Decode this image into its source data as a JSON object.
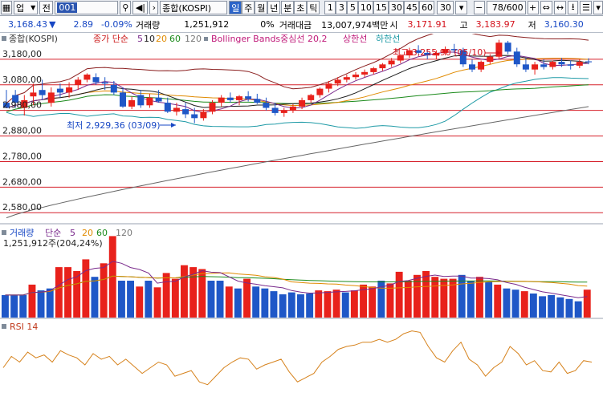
{
  "toolbar": {
    "menu_label": "업",
    "market_label": "전",
    "code": "001",
    "search_value": "종합(KOSPI)",
    "period_buttons": [
      "일",
      "주",
      "월",
      "년",
      "분",
      "초",
      "틱"
    ],
    "interval_buttons": [
      "1",
      "3",
      "5",
      "10",
      "15",
      "30",
      "45",
      "60",
      "30"
    ],
    "count_display": "78/600"
  },
  "quote": {
    "price": "3,168.43",
    "direction_symbol": "▼",
    "change": "2.89",
    "change_pct": "-0.09%",
    "volume_label": "거래량",
    "volume": "1,251,912",
    "volume_pct": "0%",
    "amount_label": "거래대금",
    "amount": "13,007,974백만",
    "open_label": "시",
    "open": "3,171.91",
    "high_label": "고",
    "high": "3,183.97",
    "low_label": "저",
    "low": "3,160.30"
  },
  "price_panel": {
    "series_name": "종합(KOSPI)",
    "legend_ma_prefix": "종가 단순",
    "ma_periods": [
      "5",
      "10",
      "20",
      "60",
      "120"
    ],
    "bollinger_label": "Bollinger Bands중심선 20,2",
    "upper_label": "상한선",
    "lower_label": "하한선",
    "high_annotation": "최고 3,255,90 (05/10)",
    "low_annotation": "최저 2,929,36 (03/09)"
  },
  "volume_panel": {
    "title": "거래량",
    "ma_prefix": "단순",
    "ma_periods": [
      "5",
      "20",
      "60",
      "120"
    ],
    "current_text": "1,251,912주(204,24%)"
  },
  "rsi_panel": {
    "title": "RSI 14"
  },
  "colors": {
    "up": "#e8211b",
    "down": "#1f57c7",
    "ma5": "#7a2a8c",
    "ma10": "#1c1c1c",
    "ma20": "#e08a00",
    "ma60": "#1b8a1b",
    "ma120": "#777777",
    "bollinger": "#8a1d1d",
    "lower_band": "#1e9aa6",
    "ma120_line": "#666666",
    "rsi": "#d6821c",
    "grid_red": "#d6202a"
  },
  "chart_data": {
    "type": "candlestick",
    "y_tick_labels": [
      "3,180,00",
      "3,080,00",
      "2,980,00",
      "2,880,00",
      "2,780,00",
      "2,680,00",
      "2,580,00"
    ],
    "y_ticks": [
      3180,
      3080,
      2980,
      2880,
      2780,
      2680,
      2580
    ],
    "ylim": [
      2540,
      3280
    ],
    "high": {
      "value": 3255.9,
      "date": "05/10"
    },
    "low": {
      "value": 2929.36,
      "date": "03/09"
    },
    "last": {
      "open": 3171.91,
      "high": 3183.97,
      "low": 3160.3,
      "close": 3168.43
    },
    "candles": [
      [
        3010,
        3060,
        2995,
        2990
      ],
      [
        3040,
        3060,
        2990,
        3010
      ],
      [
        2990,
        3040,
        2960,
        3020
      ],
      [
        3035,
        3085,
        3000,
        3050
      ],
      [
        3060,
        3100,
        3020,
        3040
      ],
      [
        3010,
        3070,
        2995,
        3050
      ],
      [
        3065,
        3085,
        3030,
        3050
      ],
      [
        3050,
        3090,
        3030,
        3070
      ],
      [
        3080,
        3110,
        3060,
        3100
      ],
      [
        3100,
        3125,
        3090,
        3120
      ],
      [
        3110,
        3125,
        3080,
        3090
      ],
      [
        3090,
        3110,
        3060,
        3085
      ],
      [
        3080,
        3095,
        3040,
        3050
      ],
      [
        3050,
        3070,
        2990,
        2995
      ],
      [
        2995,
        3035,
        2985,
        3020
      ],
      [
        3040,
        3060,
        2990,
        3000
      ],
      [
        3000,
        3045,
        2990,
        3030
      ],
      [
        3030,
        3060,
        3010,
        3015
      ],
      [
        3010,
        3030,
        2970,
        2975
      ],
      [
        2975,
        3010,
        2960,
        2990
      ],
      [
        2985,
        3010,
        2950,
        2965
      ],
      [
        2965,
        2990,
        2930,
        2950
      ],
      [
        2950,
        2985,
        2940,
        2975
      ],
      [
        2975,
        3020,
        2965,
        3010
      ],
      [
        3010,
        3040,
        2995,
        3030
      ],
      [
        3030,
        3050,
        3010,
        3020
      ],
      [
        3020,
        3040,
        3000,
        3035
      ],
      [
        3035,
        3055,
        3015,
        3025
      ],
      [
        3025,
        3045,
        3005,
        3010
      ],
      [
        3010,
        3030,
        2980,
        2990
      ],
      [
        2990,
        3010,
        2960,
        2970
      ],
      [
        2970,
        2990,
        2955,
        2980
      ],
      [
        2980,
        3005,
        2970,
        2995
      ],
      [
        2995,
        3030,
        2985,
        3020
      ],
      [
        3020,
        3045,
        3010,
        3040
      ],
      [
        3040,
        3070,
        3030,
        3065
      ],
      [
        3065,
        3095,
        3050,
        3085
      ],
      [
        3085,
        3110,
        3075,
        3100
      ],
      [
        3100,
        3120,
        3090,
        3110
      ],
      [
        3110,
        3130,
        3100,
        3120
      ],
      [
        3120,
        3140,
        3110,
        3130
      ],
      [
        3130,
        3150,
        3120,
        3145
      ],
      [
        3145,
        3165,
        3135,
        3160
      ],
      [
        3160,
        3185,
        3150,
        3175
      ],
      [
        3175,
        3200,
        3165,
        3195
      ],
      [
        3195,
        3225,
        3185,
        3215
      ],
      [
        3215,
        3235,
        3200,
        3205
      ],
      [
        3205,
        3220,
        3180,
        3195
      ],
      [
        3195,
        3215,
        3180,
        3205
      ],
      [
        3205,
        3230,
        3195,
        3220
      ],
      [
        3220,
        3240,
        3205,
        3215
      ],
      [
        3215,
        3225,
        3150,
        3160
      ],
      [
        3160,
        3180,
        3130,
        3140
      ],
      [
        3140,
        3175,
        3130,
        3170
      ],
      [
        3170,
        3200,
        3160,
        3190
      ],
      [
        3190,
        3256,
        3180,
        3245
      ],
      [
        3245,
        3252,
        3200,
        3210
      ],
      [
        3210,
        3225,
        3150,
        3160
      ],
      [
        3160,
        3185,
        3130,
        3140
      ],
      [
        3140,
        3170,
        3120,
        3160
      ],
      [
        3160,
        3180,
        3140,
        3150
      ],
      [
        3150,
        3175,
        3140,
        3170
      ],
      [
        3170,
        3185,
        3150,
        3160
      ],
      [
        3160,
        3175,
        3140,
        3155
      ],
      [
        3155,
        3180,
        3145,
        3170
      ],
      [
        3171.91,
        3183.97,
        3160.3,
        3168.43
      ]
    ],
    "volume": [
      [
        58,
        "down"
      ],
      [
        58,
        "down"
      ],
      [
        58,
        "down"
      ],
      [
        85,
        "up"
      ],
      [
        70,
        "down"
      ],
      [
        75,
        "down"
      ],
      [
        130,
        "up"
      ],
      [
        130,
        "up"
      ],
      [
        120,
        "up"
      ],
      [
        150,
        "up"
      ],
      [
        105,
        "down"
      ],
      [
        140,
        "up"
      ],
      [
        210,
        "up"
      ],
      [
        95,
        "down"
      ],
      [
        95,
        "down"
      ],
      [
        80,
        "up"
      ],
      [
        95,
        "down"
      ],
      [
        78,
        "up"
      ],
      [
        115,
        "up"
      ],
      [
        100,
        "up"
      ],
      [
        135,
        "up"
      ],
      [
        130,
        "up"
      ],
      [
        125,
        "up"
      ],
      [
        95,
        "down"
      ],
      [
        95,
        "down"
      ],
      [
        80,
        "up"
      ],
      [
        75,
        "down"
      ],
      [
        100,
        "up"
      ],
      [
        80,
        "down"
      ],
      [
        75,
        "down"
      ],
      [
        68,
        "down"
      ],
      [
        60,
        "down"
      ],
      [
        65,
        "down"
      ],
      [
        60,
        "down"
      ],
      [
        62,
        "down"
      ],
      [
        70,
        "up"
      ],
      [
        68,
        "up"
      ],
      [
        72,
        "up"
      ],
      [
        65,
        "down"
      ],
      [
        70,
        "up"
      ],
      [
        85,
        "up"
      ],
      [
        80,
        "up"
      ],
      [
        95,
        "down"
      ],
      [
        88,
        "up"
      ],
      [
        118,
        "up"
      ],
      [
        95,
        "up"
      ],
      [
        110,
        "up"
      ],
      [
        120,
        "up"
      ],
      [
        105,
        "up"
      ],
      [
        100,
        "up"
      ],
      [
        100,
        "up"
      ],
      [
        110,
        "down"
      ],
      [
        95,
        "down"
      ],
      [
        105,
        "up"
      ],
      [
        92,
        "down"
      ],
      [
        85,
        "up"
      ],
      [
        75,
        "down"
      ],
      [
        72,
        "down"
      ],
      [
        68,
        "up"
      ],
      [
        62,
        "down"
      ],
      [
        55,
        "down"
      ],
      [
        58,
        "down"
      ],
      [
        52,
        "down"
      ],
      [
        48,
        "down"
      ],
      [
        42,
        "down"
      ],
      [
        72,
        "up"
      ]
    ],
    "rsi": [
      48,
      56,
      52,
      59,
      55,
      57,
      52,
      60,
      57,
      55,
      50,
      58,
      54,
      56,
      50,
      54,
      49,
      44,
      48,
      52,
      50,
      42,
      44,
      46,
      38,
      36,
      42,
      48,
      52,
      55,
      54,
      47,
      50,
      52,
      54,
      45,
      38,
      41,
      44,
      52,
      56,
      61,
      63,
      64,
      66,
      66,
      68,
      66,
      68,
      72,
      74,
      73,
      63,
      55,
      52,
      60,
      66,
      54,
      50,
      42,
      48,
      52,
      63,
      58,
      50,
      53,
      46,
      45,
      52,
      44,
      46,
      53,
      52
    ]
  }
}
